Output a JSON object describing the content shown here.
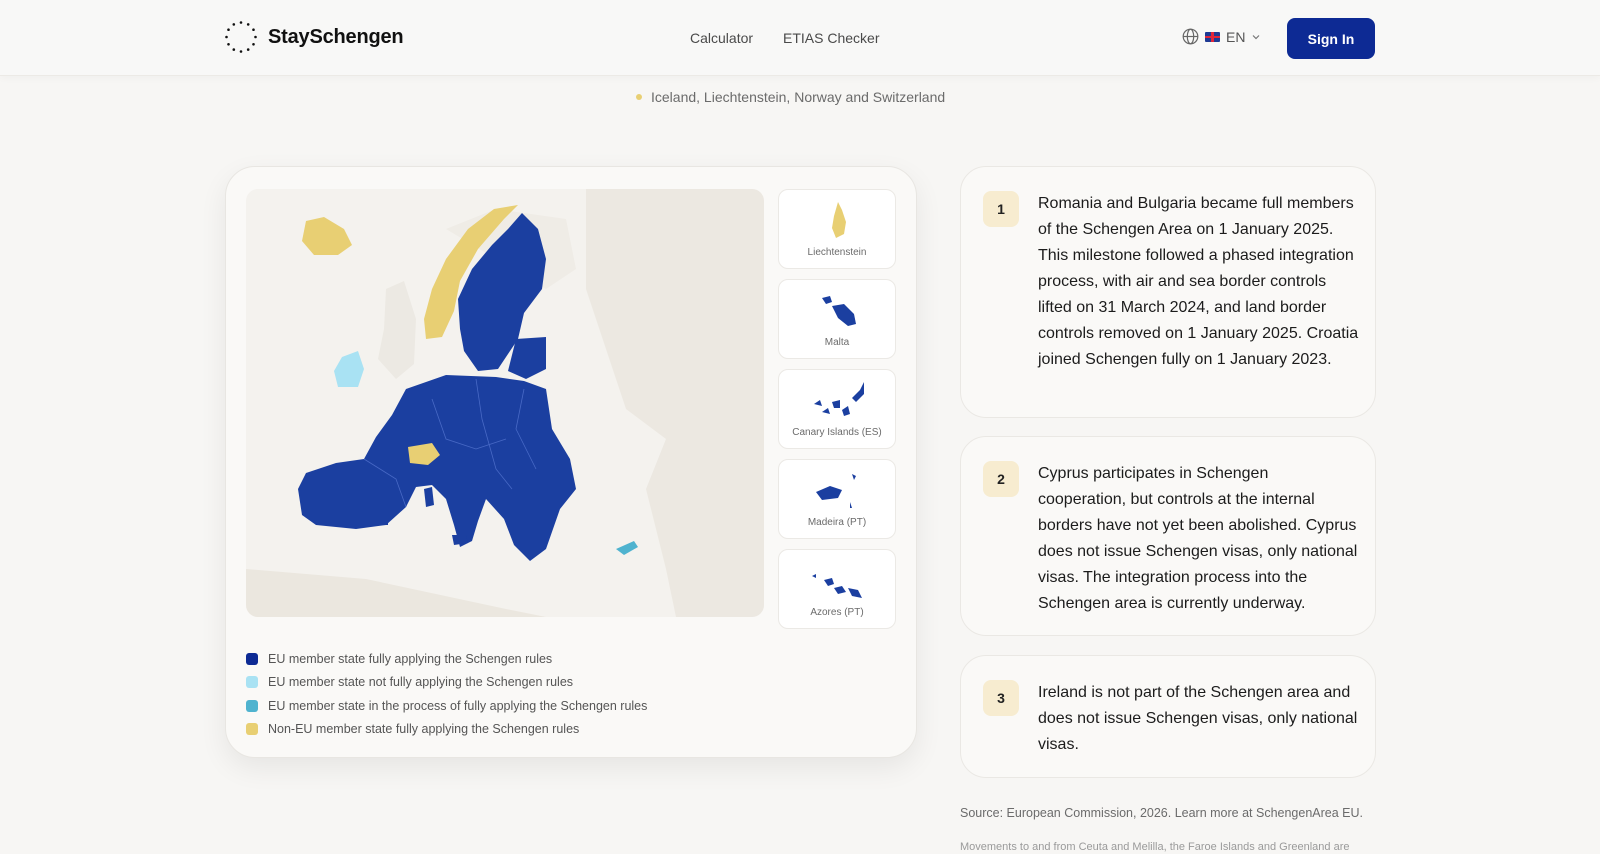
{
  "brand": {
    "name": "StaySchengen"
  },
  "nav": {
    "calculator": "Calculator",
    "etias": "ETIAS Checker"
  },
  "lang": {
    "code": "EN"
  },
  "signin": {
    "label": "Sign In"
  },
  "top_legend": {
    "text": "Iceland, Liechtenstein, Norway and Switzerland"
  },
  "insets": [
    {
      "label": "Liechtenstein"
    },
    {
      "label": "Malta"
    },
    {
      "label": "Canary Islands (ES)"
    },
    {
      "label": "Madeira (PT)"
    },
    {
      "label": "Azores (PT)"
    }
  ],
  "legend": [
    {
      "label": "EU member state fully applying the Schengen rules",
      "color": "#0d2a94"
    },
    {
      "label": "EU member state not fully applying the Schengen rules",
      "color": "#a9e2f3"
    },
    {
      "label": "EU member state in the process of fully applying the Schengen rules",
      "color": "#4fb3cf"
    },
    {
      "label": "Non-EU member state fully applying the Schengen rules",
      "color": "#e8cf73"
    }
  ],
  "notes": [
    {
      "num": "1",
      "text": "Romania and Bulgaria became full members of the Schengen Area on 1 January 2025. This milestone followed a phased integration process, with air and sea border controls lifted on 31 March 2024, and land border controls removed on 1 January 2025. Croatia joined Schengen fully on 1 January 2023."
    },
    {
      "num": "2",
      "text": "Cyprus participates in Schengen cooperation, but controls at the internal borders have not yet been abolished. Cyprus does not issue Schengen visas, only national visas. The integration process into the Schengen area is currently underway."
    },
    {
      "num": "3",
      "text": "Ireland is not part of the Schengen area and does not issue Schengen visas, only national visas."
    }
  ],
  "source": {
    "text": "Source: European Commission, 2026. Learn more at SchengenArea EU."
  },
  "footnote": {
    "text": "Movements to and from Ceuta and Melilla, the Faroe Islands and Greenland are"
  },
  "colors": {
    "accent": "#0d2a94",
    "schengen_eu": "#1b3fa0",
    "non_eu": "#e8cf73",
    "ireland": "#a9e2f3",
    "cyprus": "#4fb3cf"
  }
}
